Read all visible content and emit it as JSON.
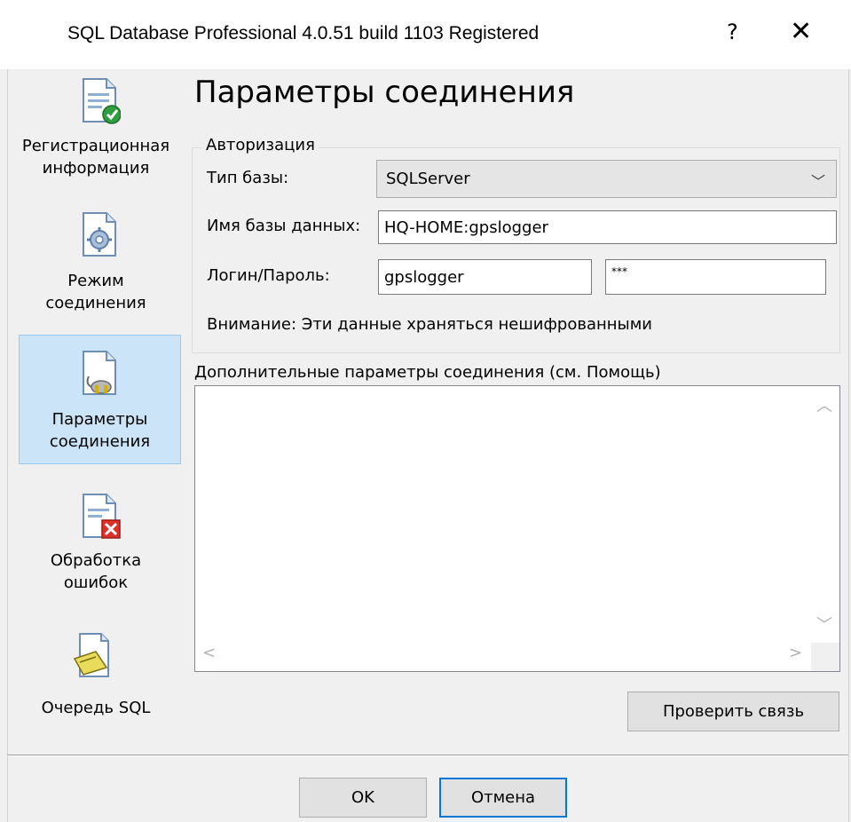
{
  "window": {
    "title": "SQL Database Professional 4.0.51 build 1103 Registered",
    "help_glyph": "?",
    "close_glyph": "✕"
  },
  "sidebar": {
    "items": [
      {
        "label_line1": "Регистрационная",
        "label_line2": "информация",
        "icon": "document-check-icon"
      },
      {
        "label_line1": "Режим",
        "label_line2": "соединения",
        "icon": "document-gear-icon"
      },
      {
        "label_line1": "Параметры",
        "label_line2": "соединения",
        "icon": "document-plug-icon",
        "selected": true
      },
      {
        "label_line1": "Обработка",
        "label_line2": "ошибок",
        "icon": "document-error-icon"
      },
      {
        "label_line1": "Очередь SQL",
        "label_line2": "",
        "icon": "document-queue-icon"
      }
    ]
  },
  "main": {
    "title": "Параметры соединения",
    "auth": {
      "legend": "Авторизация",
      "db_type_label": "Тип базы:",
      "db_type_value": "SQLServer",
      "db_name_label": "Имя базы данных:",
      "db_name_value": "HQ-HOME:gpslogger",
      "login_label": "Логин/Пароль:",
      "login_value": "gpslogger",
      "password_value": "***",
      "warning": "Внимание: Эти данные храняться нешифрованными"
    },
    "extra_label": "Дополнительные параметры соединения (см. Помощь)",
    "extra_value": "",
    "test_button": "Проверить связь"
  },
  "footer": {
    "ok": "OK",
    "cancel": "Отмена"
  },
  "colors": {
    "selected_bg": "#cce4f7",
    "accent": "#0078d7"
  }
}
